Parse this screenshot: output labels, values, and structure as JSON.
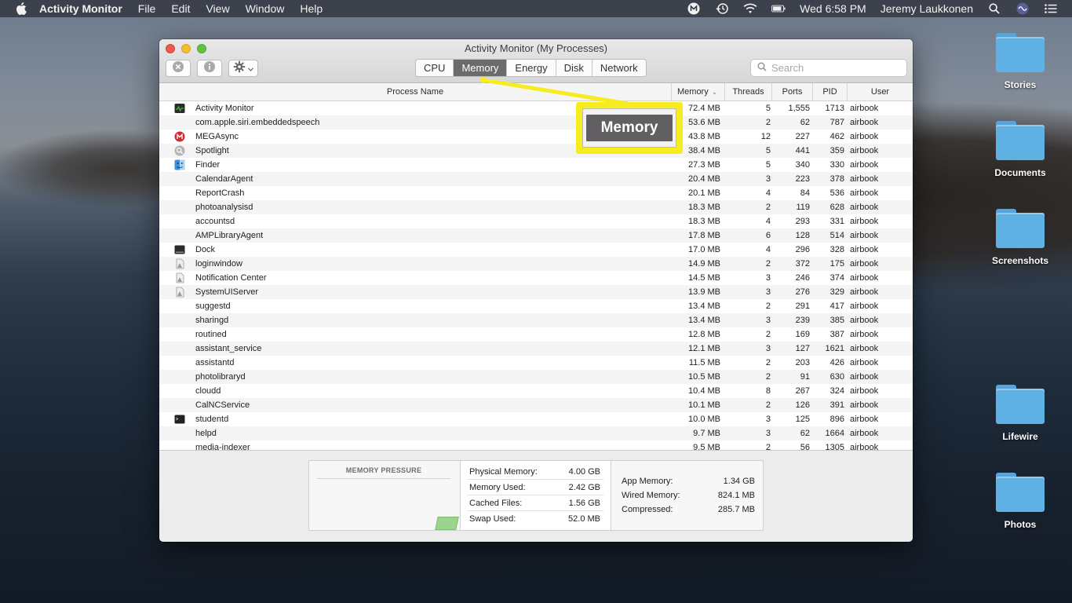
{
  "menubar": {
    "app_name": "Activity Monitor",
    "menus": [
      "File",
      "Edit",
      "View",
      "Window",
      "Help"
    ],
    "clock": "Wed 6:58 PM",
    "user": "Jeremy Laukkonen"
  },
  "desktop": {
    "folders": [
      "Stories",
      "Documents",
      "Screenshots",
      "Lifewire",
      "Photos"
    ],
    "folder_color": "#5fb0e3"
  },
  "window": {
    "title": "Activity Monitor (My Processes)",
    "tabs": [
      "CPU",
      "Memory",
      "Energy",
      "Disk",
      "Network"
    ],
    "active_tab": "Memory",
    "search_placeholder": "Search"
  },
  "table": {
    "headers": {
      "process_name": "Process Name",
      "memory": "Memory",
      "threads": "Threads",
      "ports": "Ports",
      "pid": "PID",
      "user": "User"
    },
    "rows": [
      {
        "icon": "activity-monitor-icon",
        "name": "Activity Monitor",
        "memory": "72.4 MB",
        "threads": "5",
        "ports": "1,555",
        "pid": "1713",
        "user": "airbook"
      },
      {
        "icon": "",
        "name": "com.apple.siri.embeddedspeech",
        "memory": "53.6 MB",
        "threads": "2",
        "ports": "62",
        "pid": "787",
        "user": "airbook"
      },
      {
        "icon": "mega-icon",
        "name": "MEGAsync",
        "memory": "43.8 MB",
        "threads": "12",
        "ports": "227",
        "pid": "462",
        "user": "airbook"
      },
      {
        "icon": "spotlight-icon",
        "name": "Spotlight",
        "memory": "38.4 MB",
        "threads": "5",
        "ports": "441",
        "pid": "359",
        "user": "airbook"
      },
      {
        "icon": "finder-icon",
        "name": "Finder",
        "memory": "27.3 MB",
        "threads": "5",
        "ports": "340",
        "pid": "330",
        "user": "airbook"
      },
      {
        "icon": "",
        "name": "CalendarAgent",
        "memory": "20.4 MB",
        "threads": "3",
        "ports": "223",
        "pid": "378",
        "user": "airbook"
      },
      {
        "icon": "",
        "name": "ReportCrash",
        "memory": "20.1 MB",
        "threads": "4",
        "ports": "84",
        "pid": "536",
        "user": "airbook"
      },
      {
        "icon": "",
        "name": "photoanalysisd",
        "memory": "18.3 MB",
        "threads": "2",
        "ports": "119",
        "pid": "628",
        "user": "airbook"
      },
      {
        "icon": "",
        "name": "accountsd",
        "memory": "18.3 MB",
        "threads": "4",
        "ports": "293",
        "pid": "331",
        "user": "airbook"
      },
      {
        "icon": "",
        "name": "AMPLibraryAgent",
        "memory": "17.8 MB",
        "threads": "6",
        "ports": "128",
        "pid": "514",
        "user": "airbook"
      },
      {
        "icon": "dock-icon",
        "name": "Dock",
        "memory": "17.0 MB",
        "threads": "4",
        "ports": "296",
        "pid": "328",
        "user": "airbook"
      },
      {
        "icon": "generic-app-icon",
        "name": "loginwindow",
        "memory": "14.9 MB",
        "threads": "2",
        "ports": "372",
        "pid": "175",
        "user": "airbook"
      },
      {
        "icon": "generic-app-icon",
        "name": "Notification Center",
        "memory": "14.5 MB",
        "threads": "3",
        "ports": "246",
        "pid": "374",
        "user": "airbook"
      },
      {
        "icon": "generic-app-icon",
        "name": "SystemUIServer",
        "memory": "13.9 MB",
        "threads": "3",
        "ports": "276",
        "pid": "329",
        "user": "airbook"
      },
      {
        "icon": "",
        "name": "suggestd",
        "memory": "13.4 MB",
        "threads": "2",
        "ports": "291",
        "pid": "417",
        "user": "airbook"
      },
      {
        "icon": "",
        "name": "sharingd",
        "memory": "13.4 MB",
        "threads": "3",
        "ports": "239",
        "pid": "385",
        "user": "airbook"
      },
      {
        "icon": "",
        "name": "routined",
        "memory": "12.8 MB",
        "threads": "2",
        "ports": "169",
        "pid": "387",
        "user": "airbook"
      },
      {
        "icon": "",
        "name": "assistant_service",
        "memory": "12.1 MB",
        "threads": "3",
        "ports": "127",
        "pid": "1621",
        "user": "airbook"
      },
      {
        "icon": "",
        "name": "assistantd",
        "memory": "11.5 MB",
        "threads": "2",
        "ports": "203",
        "pid": "426",
        "user": "airbook"
      },
      {
        "icon": "",
        "name": "photolibraryd",
        "memory": "10.5 MB",
        "threads": "2",
        "ports": "91",
        "pid": "630",
        "user": "airbook"
      },
      {
        "icon": "",
        "name": "cloudd",
        "memory": "10.4 MB",
        "threads": "8",
        "ports": "267",
        "pid": "324",
        "user": "airbook"
      },
      {
        "icon": "",
        "name": "CalNCService",
        "memory": "10.1 MB",
        "threads": "2",
        "ports": "126",
        "pid": "391",
        "user": "airbook"
      },
      {
        "icon": "terminal-icon",
        "name": "studentd",
        "memory": "10.0 MB",
        "threads": "3",
        "ports": "125",
        "pid": "896",
        "user": "airbook"
      },
      {
        "icon": "",
        "name": "helpd",
        "memory": "9.7 MB",
        "threads": "3",
        "ports": "62",
        "pid": "1664",
        "user": "airbook"
      },
      {
        "icon": "",
        "name": "media-indexer",
        "memory": "9.5 MB",
        "threads": "2",
        "ports": "56",
        "pid": "1305",
        "user": "airbook"
      }
    ]
  },
  "footer": {
    "pressure_title": "MEMORY PRESSURE",
    "pressure_color": "#9ad48f",
    "stats_mid": [
      {
        "label": "Physical Memory:",
        "value": "4.00 GB"
      },
      {
        "label": "Memory Used:",
        "value": "2.42 GB"
      },
      {
        "label": "Cached Files:",
        "value": "1.56 GB"
      },
      {
        "label": "Swap Used:",
        "value": "52.0 MB"
      }
    ],
    "stats_right": [
      {
        "label": "App Memory:",
        "value": "1.34 GB"
      },
      {
        "label": "Wired Memory:",
        "value": "824.1 MB"
      },
      {
        "label": "Compressed:",
        "value": "285.7 MB"
      }
    ]
  },
  "callout": {
    "label": "Memory",
    "color": "#f6ec1f"
  }
}
